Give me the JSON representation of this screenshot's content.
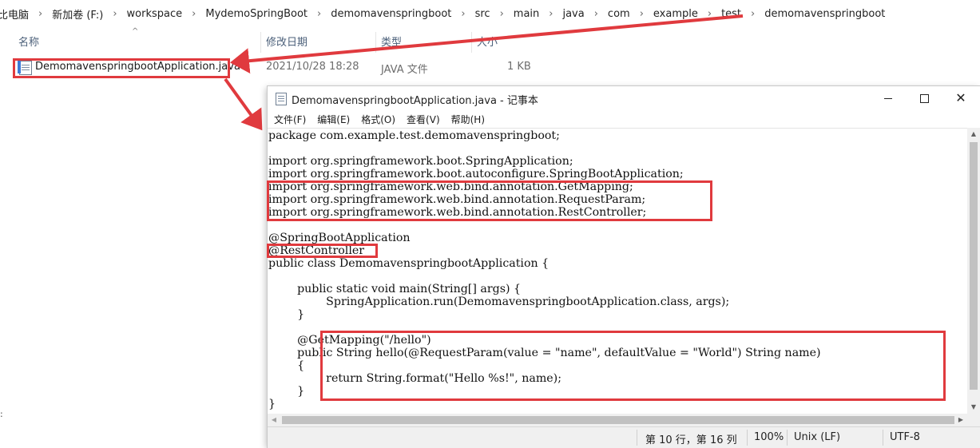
{
  "breadcrumb": [
    "比电脑",
    "新加卷 (F:)",
    "workspace",
    "MydemoSpringBoot",
    "demomavenspringboot",
    "src",
    "main",
    "java",
    "com",
    "example",
    "test",
    "demomavenspringboot"
  ],
  "columns": {
    "name": "名称",
    "date": "修改日期",
    "type": "类型",
    "size": "大小"
  },
  "file": {
    "name": "DemomavenspringbootApplication.java",
    "date": "2021/10/28 18:28",
    "type": "JAVA 文件",
    "size": "1 KB"
  },
  "notepad": {
    "title": "DemomavenspringbootApplication.java - 记事本",
    "menu": [
      "文件(F)",
      "编辑(E)",
      "格式(O)",
      "查看(V)",
      "帮助(H)"
    ],
    "code": [
      "package com.example.test.demomavenspringboot;",
      "",
      "import org.springframework.boot.SpringApplication;",
      "import org.springframework.boot.autoconfigure.SpringBootApplication;",
      "import org.springframework.web.bind.annotation.GetMapping;",
      "import org.springframework.web.bind.annotation.RequestParam;",
      "import org.springframework.web.bind.annotation.RestController;",
      "",
      "@SpringBootApplication",
      "@RestController",
      "public class DemomavenspringbootApplication {",
      "",
      "        public static void main(String[] args) {",
      "                SpringApplication.run(DemomavenspringbootApplication.class, args);",
      "        }",
      "",
      "        @GetMapping(\"/hello\")",
      "        public String hello(@RequestParam(value = \"name\", defaultValue = \"World\") String name)",
      "        {",
      "                return String.format(\"Hello %s!\", name);",
      "        }",
      "}"
    ],
    "status": {
      "position": "第 10 行，第 16 列",
      "zoom": "100%",
      "line_ending": "Unix (LF)",
      "encoding": "UTF-8"
    }
  },
  "colors": {
    "annotation": "#e03a3e"
  }
}
